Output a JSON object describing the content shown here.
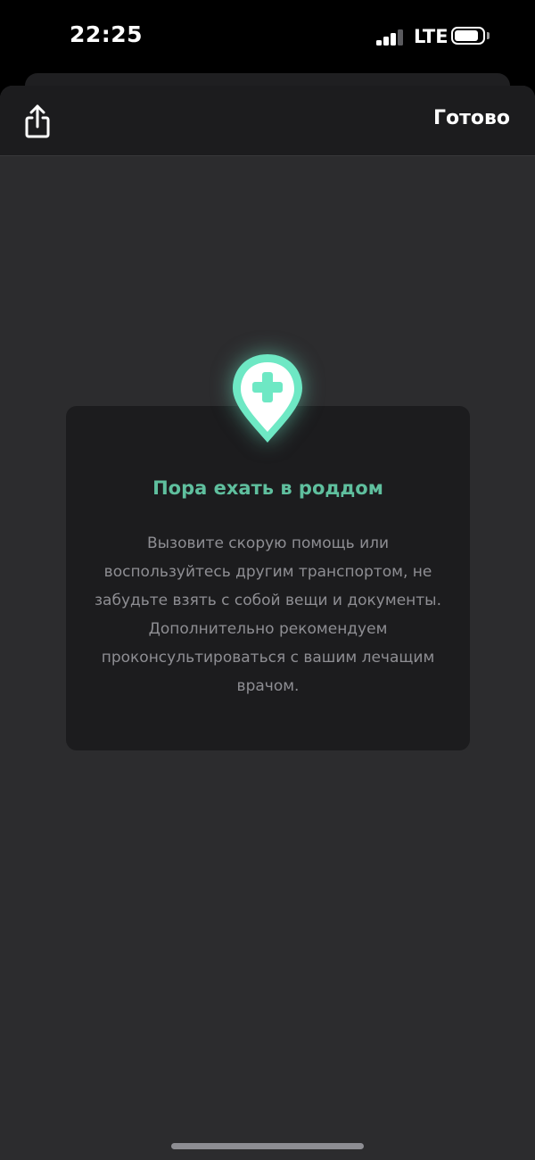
{
  "status_bar": {
    "time": "22:25",
    "network": "LTE",
    "signal_bars_total": 4,
    "signal_bars_active": 3,
    "battery_level": 0.85
  },
  "nav_bar": {
    "share_icon": "share-icon",
    "done_label": "Готово"
  },
  "card": {
    "icon": "medical-location-pin-icon",
    "title": "Пора ехать в роддом",
    "text": "Вызовите скорую помощь или воспользуйтесь другим транспортом, не забудьте взять с собой вещи и документы. Дополнительно рекомендуем проконсультироваться с вашим лечащим врачом."
  },
  "colors": {
    "background": "#2c2c2e",
    "nav_background": "#1c1c1e",
    "card_background": "#1c1c1e",
    "accent": "#6ee8c4",
    "title": "#5fbf9e",
    "body_text": "#8e8e93"
  }
}
